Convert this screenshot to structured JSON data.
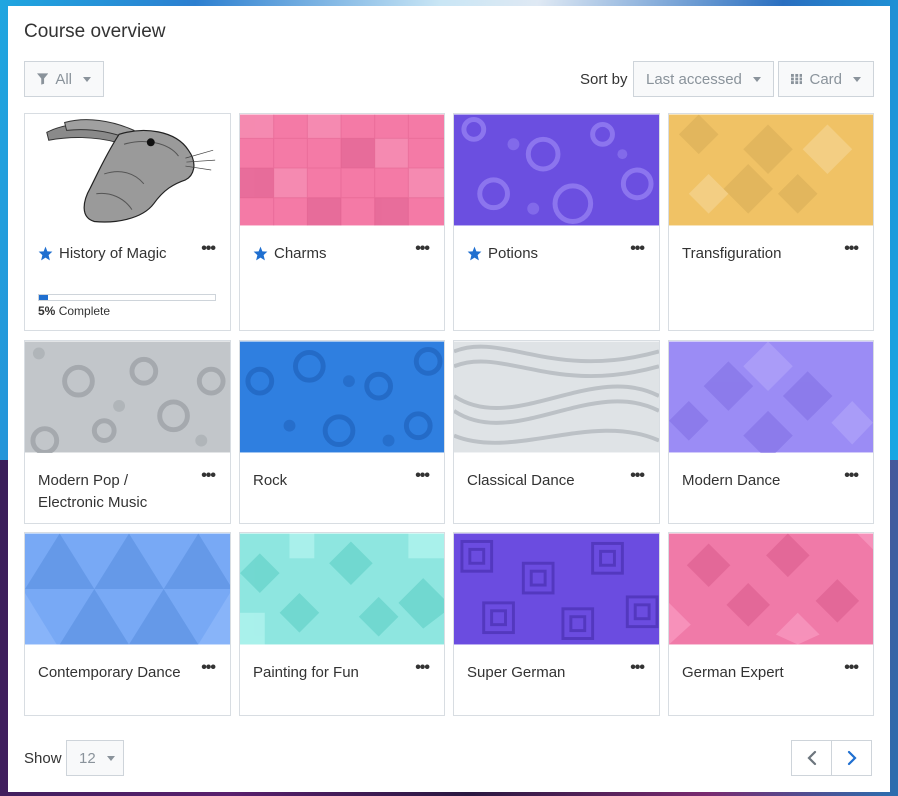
{
  "header": {
    "title": "Course overview"
  },
  "filter": {
    "label": "All"
  },
  "sort": {
    "label": "Sort by",
    "value": "Last accessed"
  },
  "view": {
    "label": "Card"
  },
  "courses": [
    {
      "name": "History of Magic",
      "starred": true,
      "progress_percent": "5%",
      "progress_text": "Complete"
    },
    {
      "name": "Charms",
      "starred": true
    },
    {
      "name": "Potions",
      "starred": true
    },
    {
      "name": "Transfiguration",
      "starred": false
    },
    {
      "name": "Modern Pop / Electronic Music",
      "starred": false
    },
    {
      "name": "Rock",
      "starred": false
    },
    {
      "name": "Classical Dance",
      "starred": false
    },
    {
      "name": "Modern Dance",
      "starred": false
    },
    {
      "name": "Contemporary Dance",
      "starred": false
    },
    {
      "name": "Painting for Fun",
      "starred": false
    },
    {
      "name": "Super German",
      "starred": false
    },
    {
      "name": "German Expert",
      "starred": false
    }
  ],
  "course_menu_label": "•••",
  "pagination": {
    "show_label": "Show",
    "per_page": "12"
  },
  "colors": {
    "accent": "#1f6fd0",
    "pink": "#f47aa6",
    "purple": "#6b4fe0",
    "gold": "#f0c265",
    "gray": "#c2c6ca",
    "blue": "#2f7fe0",
    "silver": "#dfe3e6",
    "lavender": "#9b8cf5",
    "lightblue": "#78a9f5",
    "aqua": "#8ee6e0",
    "violet": "#6b4ce0",
    "hotpink": "#f07aa8"
  }
}
